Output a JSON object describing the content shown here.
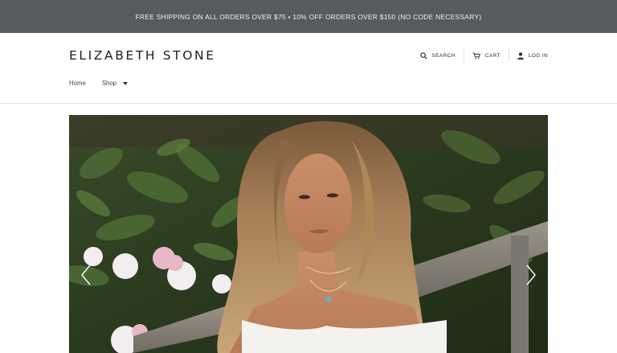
{
  "announcement": {
    "text": "FREE SHIPPING ON ALL ORDERS OVER $75 • 10% OFF ORDERS OVER $150 (NO CODE NECESSARY)"
  },
  "header": {
    "logo": "ELIZABETH STONE",
    "utility_nav": {
      "search_label": "SEARCH",
      "search_icon": "search-icon",
      "cart_label": "CART",
      "cart_icon": "cart-icon",
      "login_label": "LOG IN",
      "login_icon": "user-icon"
    },
    "main_nav": {
      "items": [
        {
          "label": "Home"
        },
        {
          "label": "Shop",
          "has_dropdown": true
        }
      ]
    }
  },
  "hero": {
    "slide_image": "woman-wearing-layered-necklaces-photo",
    "prev_icon": "chevron-left-icon",
    "next_icon": "chevron-right-icon"
  },
  "colors": {
    "announcement_bg": "#565b5e",
    "announcement_text": "#f1f1f1",
    "logo_text": "#1d1d1d",
    "border": "#e3e3e3"
  }
}
